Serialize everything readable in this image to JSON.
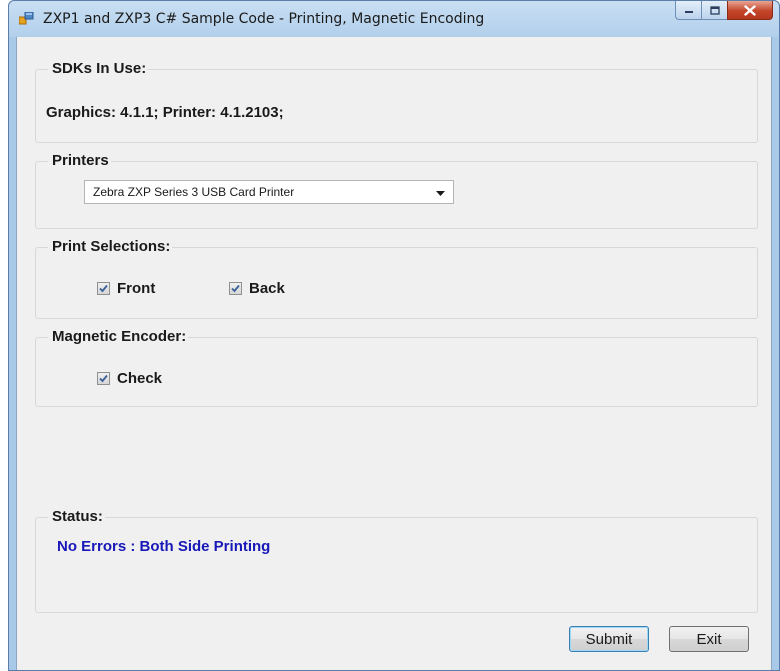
{
  "window": {
    "title": "ZXP1 and ZXP3 C# Sample Code - Printing, Magnetic Encoding"
  },
  "sdks": {
    "label": "SDKs In Use:",
    "versions": "Graphics: 4.1.1; Printer: 4.1.2103;"
  },
  "printers": {
    "label": "Printers",
    "selected": "Zebra ZXP Series 3 USB Card Printer"
  },
  "print_selections": {
    "label": "Print Selections:",
    "front": {
      "label": "Front",
      "checked": true
    },
    "back": {
      "label": "Back",
      "checked": true
    }
  },
  "magnetic_encoder": {
    "label": "Magnetic Encoder:",
    "check": {
      "label": "Check",
      "checked": true
    }
  },
  "status": {
    "label": "Status:",
    "message": "No Errors : Both Side Printing",
    "message_color": "#1818b8"
  },
  "buttons": {
    "submit": "Submit",
    "exit": "Exit"
  },
  "icons": {
    "app": "app-window-icon",
    "minimize": "minimize-icon",
    "maximize": "maximize-icon",
    "close": "close-icon",
    "dropdown": "chevron-down-icon",
    "checkmark": "checkmark-icon"
  }
}
